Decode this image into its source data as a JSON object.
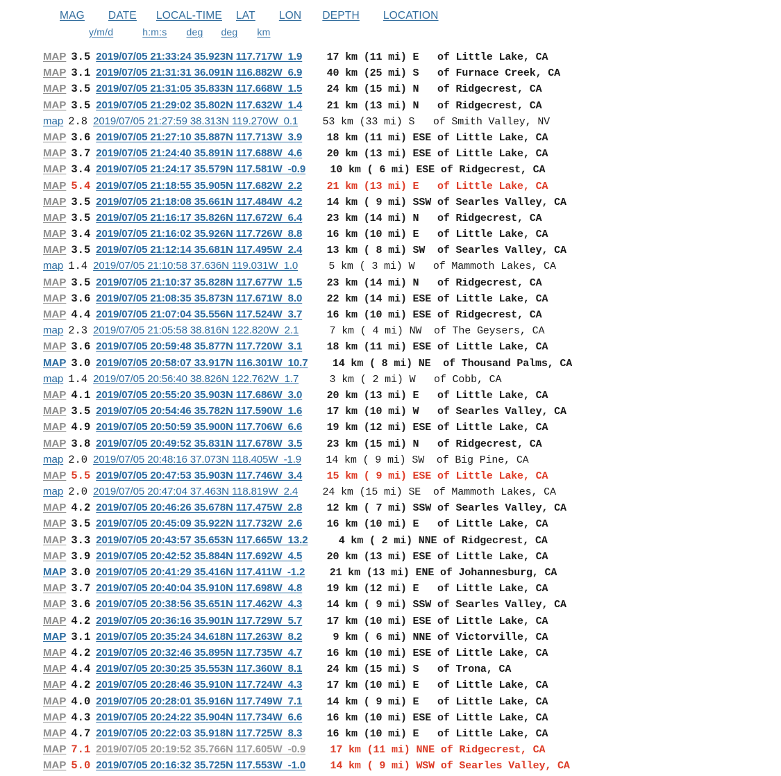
{
  "header": {
    "columns": [
      "MAG",
      "DATE",
      "LOCAL-TIME",
      "LAT",
      "LON",
      "DEPTH",
      "LOCATION"
    ],
    "units": [
      "y/m/d",
      "h:m:s",
      "deg",
      "deg",
      "km"
    ]
  },
  "colors": {
    "link_blue": "#2a6ba0",
    "link_visited_gray": "#8d8d8d",
    "alert_red": "#dd3b26",
    "text": "#1a1a1a",
    "background": "#ffffff"
  },
  "map_label_visited": "MAP",
  "map_label_unvisited": "map",
  "rows": [
    {
      "map": "MAP",
      "map_visited": true,
      "mag": "3.5",
      "date": "2019/07/05",
      "time": "21:33:24",
      "lat": "35.923N",
      "lon": "117.717W",
      "depth": "1.9",
      "dist_km": "17",
      "dist_mi": "11",
      "dir": "E",
      "place": "of Little Lake, CA",
      "bold": true,
      "red": false,
      "detail_visited": false
    },
    {
      "map": "MAP",
      "map_visited": true,
      "mag": "3.1",
      "date": "2019/07/05",
      "time": "21:31:31",
      "lat": "36.091N",
      "lon": "116.882W",
      "depth": "6.9",
      "dist_km": "40",
      "dist_mi": "25",
      "dir": "S",
      "place": "of Furnace Creek, CA",
      "bold": true,
      "red": false,
      "detail_visited": false
    },
    {
      "map": "MAP",
      "map_visited": true,
      "mag": "3.5",
      "date": "2019/07/05",
      "time": "21:31:05",
      "lat": "35.833N",
      "lon": "117.668W",
      "depth": "1.5",
      "dist_km": "24",
      "dist_mi": "15",
      "dir": "N",
      "place": "of Ridgecrest, CA",
      "bold": true,
      "red": false,
      "detail_visited": false
    },
    {
      "map": "MAP",
      "map_visited": true,
      "mag": "3.5",
      "date": "2019/07/05",
      "time": "21:29:02",
      "lat": "35.802N",
      "lon": "117.632W",
      "depth": "1.4",
      "dist_km": "21",
      "dist_mi": "13",
      "dir": "N",
      "place": "of Ridgecrest, CA",
      "bold": true,
      "red": false,
      "detail_visited": false
    },
    {
      "map": "map",
      "map_visited": false,
      "mag": "2.8",
      "date": "2019/07/05",
      "time": "21:27:59",
      "lat": "38.313N",
      "lon": "119.270W",
      "depth": "0.1",
      "dist_km": "53",
      "dist_mi": "33",
      "dir": "S",
      "place": "of Smith Valley, NV",
      "bold": false,
      "red": false,
      "detail_visited": false
    },
    {
      "map": "MAP",
      "map_visited": true,
      "mag": "3.6",
      "date": "2019/07/05",
      "time": "21:27:10",
      "lat": "35.887N",
      "lon": "117.713W",
      "depth": "3.9",
      "dist_km": "18",
      "dist_mi": "11",
      "dir": "ESE",
      "place": "of Little Lake, CA",
      "bold": true,
      "red": false,
      "detail_visited": false
    },
    {
      "map": "MAP",
      "map_visited": true,
      "mag": "3.7",
      "date": "2019/07/05",
      "time": "21:24:40",
      "lat": "35.891N",
      "lon": "117.688W",
      "depth": "4.6",
      "dist_km": "20",
      "dist_mi": "13",
      "dir": "ESE",
      "place": "of Little Lake, CA",
      "bold": true,
      "red": false,
      "detail_visited": false
    },
    {
      "map": "MAP",
      "map_visited": true,
      "mag": "3.4",
      "date": "2019/07/05",
      "time": "21:24:17",
      "lat": "35.579N",
      "lon": "117.581W",
      "depth": "-0.9",
      "dist_km": "10",
      "dist_mi": " 6",
      "dir": "ESE",
      "place": "of Ridgecrest, CA",
      "bold": true,
      "red": false,
      "detail_visited": false
    },
    {
      "map": "MAP",
      "map_visited": true,
      "mag": "5.4",
      "date": "2019/07/05",
      "time": "21:18:55",
      "lat": "35.905N",
      "lon": "117.682W",
      "depth": "2.2",
      "dist_km": "21",
      "dist_mi": "13",
      "dir": "E",
      "place": "of Little Lake, CA",
      "bold": true,
      "red": true,
      "detail_visited": false
    },
    {
      "map": "MAP",
      "map_visited": true,
      "mag": "3.5",
      "date": "2019/07/05",
      "time": "21:18:08",
      "lat": "35.661N",
      "lon": "117.484W",
      "depth": "4.2",
      "dist_km": "14",
      "dist_mi": " 9",
      "dir": "SSW",
      "place": "of Searles Valley, CA",
      "bold": true,
      "red": false,
      "detail_visited": false
    },
    {
      "map": "MAP",
      "map_visited": true,
      "mag": "3.5",
      "date": "2019/07/05",
      "time": "21:16:17",
      "lat": "35.826N",
      "lon": "117.672W",
      "depth": "6.4",
      "dist_km": "23",
      "dist_mi": "14",
      "dir": "N",
      "place": "of Ridgecrest, CA",
      "bold": true,
      "red": false,
      "detail_visited": false
    },
    {
      "map": "MAP",
      "map_visited": true,
      "mag": "3.4",
      "date": "2019/07/05",
      "time": "21:16:02",
      "lat": "35.926N",
      "lon": "117.726W",
      "depth": "8.8",
      "dist_km": "16",
      "dist_mi": "10",
      "dir": "E",
      "place": "of Little Lake, CA",
      "bold": true,
      "red": false,
      "detail_visited": false
    },
    {
      "map": "MAP",
      "map_visited": true,
      "mag": "3.5",
      "date": "2019/07/05",
      "time": "21:12:14",
      "lat": "35.681N",
      "lon": "117.495W",
      "depth": "2.4",
      "dist_km": "13",
      "dist_mi": " 8",
      "dir": "SW",
      "place": "of Searles Valley, CA",
      "bold": true,
      "red": false,
      "detail_visited": false
    },
    {
      "map": "map",
      "map_visited": false,
      "mag": "1.4",
      "date": "2019/07/05",
      "time": "21:10:58",
      "lat": "37.636N",
      "lon": "119.031W",
      "depth": "1.0",
      "dist_km": " 5",
      "dist_mi": " 3",
      "dir": "W",
      "place": "of Mammoth Lakes, CA",
      "bold": false,
      "red": false,
      "detail_visited": false
    },
    {
      "map": "MAP",
      "map_visited": true,
      "mag": "3.5",
      "date": "2019/07/05",
      "time": "21:10:37",
      "lat": "35.828N",
      "lon": "117.677W",
      "depth": "1.5",
      "dist_km": "23",
      "dist_mi": "14",
      "dir": "N",
      "place": "of Ridgecrest, CA",
      "bold": true,
      "red": false,
      "detail_visited": false
    },
    {
      "map": "MAP",
      "map_visited": true,
      "mag": "3.6",
      "date": "2019/07/05",
      "time": "21:08:35",
      "lat": "35.873N",
      "lon": "117.671W",
      "depth": "8.0",
      "dist_km": "22",
      "dist_mi": "14",
      "dir": "ESE",
      "place": "of Little Lake, CA",
      "bold": true,
      "red": false,
      "detail_visited": false
    },
    {
      "map": "MAP",
      "map_visited": true,
      "mag": "4.4",
      "date": "2019/07/05",
      "time": "21:07:04",
      "lat": "35.556N",
      "lon": "117.524W",
      "depth": "3.7",
      "dist_km": "16",
      "dist_mi": "10",
      "dir": "ESE",
      "place": "of Ridgecrest, CA",
      "bold": true,
      "red": false,
      "detail_visited": false
    },
    {
      "map": "map",
      "map_visited": false,
      "mag": "2.3",
      "date": "2019/07/05",
      "time": "21:05:58",
      "lat": "38.816N",
      "lon": "122.820W",
      "depth": "2.1",
      "dist_km": " 7",
      "dist_mi": " 4",
      "dir": "NW",
      "place": "of The Geysers, CA",
      "bold": false,
      "red": false,
      "detail_visited": false
    },
    {
      "map": "MAP",
      "map_visited": true,
      "mag": "3.6",
      "date": "2019/07/05",
      "time": "20:59:48",
      "lat": "35.877N",
      "lon": "117.720W",
      "depth": "3.1",
      "dist_km": "18",
      "dist_mi": "11",
      "dir": "ESE",
      "place": "of Little Lake, CA",
      "bold": true,
      "red": false,
      "detail_visited": false
    },
    {
      "map": "MAP",
      "map_visited": false,
      "mag": "3.0",
      "date": "2019/07/05",
      "time": "20:58:07",
      "lat": "33.917N",
      "lon": "116.301W",
      "depth": "10.7",
      "dist_km": "14",
      "dist_mi": " 8",
      "dir": "NE",
      "place": "of Thousand Palms, CA",
      "bold": true,
      "red": false,
      "detail_visited": false
    },
    {
      "map": "map",
      "map_visited": false,
      "mag": "1.4",
      "date": "2019/07/05",
      "time": "20:56:40",
      "lat": "38.826N",
      "lon": "122.762W",
      "depth": "1.7",
      "dist_km": " 3",
      "dist_mi": " 2",
      "dir": "W",
      "place": "of Cobb, CA",
      "bold": false,
      "red": false,
      "detail_visited": false
    },
    {
      "map": "MAP",
      "map_visited": true,
      "mag": "4.1",
      "date": "2019/07/05",
      "time": "20:55:20",
      "lat": "35.903N",
      "lon": "117.686W",
      "depth": "3.0",
      "dist_km": "20",
      "dist_mi": "13",
      "dir": "E",
      "place": "of Little Lake, CA",
      "bold": true,
      "red": false,
      "detail_visited": false
    },
    {
      "map": "MAP",
      "map_visited": true,
      "mag": "3.5",
      "date": "2019/07/05",
      "time": "20:54:46",
      "lat": "35.782N",
      "lon": "117.590W",
      "depth": "1.6",
      "dist_km": "17",
      "dist_mi": "10",
      "dir": "W",
      "place": "of Searles Valley, CA",
      "bold": true,
      "red": false,
      "detail_visited": false
    },
    {
      "map": "MAP",
      "map_visited": true,
      "mag": "4.9",
      "date": "2019/07/05",
      "time": "20:50:59",
      "lat": "35.900N",
      "lon": "117.706W",
      "depth": "6.6",
      "dist_km": "19",
      "dist_mi": "12",
      "dir": "ESE",
      "place": "of Little Lake, CA",
      "bold": true,
      "red": false,
      "detail_visited": false
    },
    {
      "map": "MAP",
      "map_visited": true,
      "mag": "3.8",
      "date": "2019/07/05",
      "time": "20:49:52",
      "lat": "35.831N",
      "lon": "117.678W",
      "depth": "3.5",
      "dist_km": "23",
      "dist_mi": "15",
      "dir": "N",
      "place": "of Ridgecrest, CA",
      "bold": true,
      "red": false,
      "detail_visited": false
    },
    {
      "map": "map",
      "map_visited": false,
      "mag": "2.0",
      "date": "2019/07/05",
      "time": "20:48:16",
      "lat": "37.073N",
      "lon": "118.405W",
      "depth": "-1.9",
      "dist_km": "14",
      "dist_mi": " 9",
      "dir": "SW",
      "place": "of Big Pine, CA",
      "bold": false,
      "red": false,
      "detail_visited": false
    },
    {
      "map": "MAP",
      "map_visited": true,
      "mag": "5.5",
      "date": "2019/07/05",
      "time": "20:47:53",
      "lat": "35.903N",
      "lon": "117.746W",
      "depth": "3.4",
      "dist_km": "15",
      "dist_mi": " 9",
      "dir": "ESE",
      "place": "of Little Lake, CA",
      "bold": true,
      "red": true,
      "detail_visited": false
    },
    {
      "map": "map",
      "map_visited": false,
      "mag": "2.0",
      "date": "2019/07/05",
      "time": "20:47:04",
      "lat": "37.463N",
      "lon": "118.819W",
      "depth": "2.4",
      "dist_km": "24",
      "dist_mi": "15",
      "dir": "SE",
      "place": "of Mammoth Lakes, CA",
      "bold": false,
      "red": false,
      "detail_visited": false
    },
    {
      "map": "MAP",
      "map_visited": true,
      "mag": "4.2",
      "date": "2019/07/05",
      "time": "20:46:26",
      "lat": "35.678N",
      "lon": "117.475W",
      "depth": "2.8",
      "dist_km": "12",
      "dist_mi": " 7",
      "dir": "SSW",
      "place": "of Searles Valley, CA",
      "bold": true,
      "red": false,
      "detail_visited": false
    },
    {
      "map": "MAP",
      "map_visited": true,
      "mag": "3.5",
      "date": "2019/07/05",
      "time": "20:45:09",
      "lat": "35.922N",
      "lon": "117.732W",
      "depth": "2.6",
      "dist_km": "16",
      "dist_mi": "10",
      "dir": "E",
      "place": "of Little Lake, CA",
      "bold": true,
      "red": false,
      "detail_visited": false
    },
    {
      "map": "MAP",
      "map_visited": true,
      "mag": "3.3",
      "date": "2019/07/05",
      "time": "20:43:57",
      "lat": "35.653N",
      "lon": "117.665W",
      "depth": "13.2",
      "dist_km": " 4",
      "dist_mi": " 2",
      "dir": "NNE",
      "place": "of Ridgecrest, CA",
      "bold": true,
      "red": false,
      "detail_visited": false
    },
    {
      "map": "MAP",
      "map_visited": true,
      "mag": "3.9",
      "date": "2019/07/05",
      "time": "20:42:52",
      "lat": "35.884N",
      "lon": "117.692W",
      "depth": "4.5",
      "dist_km": "20",
      "dist_mi": "13",
      "dir": "ESE",
      "place": "of Little Lake, CA",
      "bold": true,
      "red": false,
      "detail_visited": false
    },
    {
      "map": "MAP",
      "map_visited": false,
      "mag": "3.0",
      "date": "2019/07/05",
      "time": "20:41:29",
      "lat": "35.416N",
      "lon": "117.411W",
      "depth": "-1.2",
      "dist_km": "21",
      "dist_mi": "13",
      "dir": "ENE",
      "place": "of Johannesburg, CA",
      "bold": true,
      "red": false,
      "detail_visited": false
    },
    {
      "map": "MAP",
      "map_visited": true,
      "mag": "3.7",
      "date": "2019/07/05",
      "time": "20:40:04",
      "lat": "35.910N",
      "lon": "117.698W",
      "depth": "4.8",
      "dist_km": "19",
      "dist_mi": "12",
      "dir": "E",
      "place": "of Little Lake, CA",
      "bold": true,
      "red": false,
      "detail_visited": false
    },
    {
      "map": "MAP",
      "map_visited": true,
      "mag": "3.6",
      "date": "2019/07/05",
      "time": "20:38:56",
      "lat": "35.651N",
      "lon": "117.462W",
      "depth": "4.3",
      "dist_km": "14",
      "dist_mi": " 9",
      "dir": "SSW",
      "place": "of Searles Valley, CA",
      "bold": true,
      "red": false,
      "detail_visited": false
    },
    {
      "map": "MAP",
      "map_visited": true,
      "mag": "4.2",
      "date": "2019/07/05",
      "time": "20:36:16",
      "lat": "35.901N",
      "lon": "117.729W",
      "depth": "5.7",
      "dist_km": "17",
      "dist_mi": "10",
      "dir": "ESE",
      "place": "of Little Lake, CA",
      "bold": true,
      "red": false,
      "detail_visited": false
    },
    {
      "map": "MAP",
      "map_visited": false,
      "mag": "3.1",
      "date": "2019/07/05",
      "time": "20:35:24",
      "lat": "34.618N",
      "lon": "117.263W",
      "depth": "8.2",
      "dist_km": " 9",
      "dist_mi": " 6",
      "dir": "NNE",
      "place": "of Victorville, CA",
      "bold": true,
      "red": false,
      "detail_visited": false
    },
    {
      "map": "MAP",
      "map_visited": true,
      "mag": "4.2",
      "date": "2019/07/05",
      "time": "20:32:46",
      "lat": "35.895N",
      "lon": "117.735W",
      "depth": "4.7",
      "dist_km": "16",
      "dist_mi": "10",
      "dir": "ESE",
      "place": "of Little Lake, CA",
      "bold": true,
      "red": false,
      "detail_visited": false
    },
    {
      "map": "MAP",
      "map_visited": true,
      "mag": "4.4",
      "date": "2019/07/05",
      "time": "20:30:25",
      "lat": "35.553N",
      "lon": "117.360W",
      "depth": "8.1",
      "dist_km": "24",
      "dist_mi": "15",
      "dir": "S",
      "place": "of Trona, CA",
      "bold": true,
      "red": false,
      "detail_visited": false
    },
    {
      "map": "MAP",
      "map_visited": true,
      "mag": "4.2",
      "date": "2019/07/05",
      "time": "20:28:46",
      "lat": "35.910N",
      "lon": "117.724W",
      "depth": "4.3",
      "dist_km": "17",
      "dist_mi": "10",
      "dir": "E",
      "place": "of Little Lake, CA",
      "bold": true,
      "red": false,
      "detail_visited": false
    },
    {
      "map": "MAP",
      "map_visited": true,
      "mag": "4.0",
      "date": "2019/07/05",
      "time": "20:28:01",
      "lat": "35.916N",
      "lon": "117.749W",
      "depth": "7.1",
      "dist_km": "14",
      "dist_mi": " 9",
      "dir": "E",
      "place": "of Little Lake, CA",
      "bold": true,
      "red": false,
      "detail_visited": false
    },
    {
      "map": "MAP",
      "map_visited": true,
      "mag": "4.3",
      "date": "2019/07/05",
      "time": "20:24:22",
      "lat": "35.904N",
      "lon": "117.734W",
      "depth": "6.6",
      "dist_km": "16",
      "dist_mi": "10",
      "dir": "ESE",
      "place": "of Little Lake, CA",
      "bold": true,
      "red": false,
      "detail_visited": false
    },
    {
      "map": "MAP",
      "map_visited": true,
      "mag": "4.7",
      "date": "2019/07/05",
      "time": "20:22:03",
      "lat": "35.918N",
      "lon": "117.725W",
      "depth": "8.3",
      "dist_km": "16",
      "dist_mi": "10",
      "dir": "E",
      "place": "of Little Lake, CA",
      "bold": true,
      "red": false,
      "detail_visited": false
    },
    {
      "map": "MAP",
      "map_visited": true,
      "mag": "7.1",
      "date": "2019/07/05",
      "time": "20:19:52",
      "lat": "35.766N",
      "lon": "117.605W",
      "depth": "-0.9",
      "dist_km": "17",
      "dist_mi": "11",
      "dir": "NNE",
      "place": "of Ridgecrest, CA",
      "bold": true,
      "red": true,
      "detail_visited": true
    },
    {
      "map": "MAP",
      "map_visited": true,
      "mag": "5.0",
      "date": "2019/07/05",
      "time": "20:16:32",
      "lat": "35.725N",
      "lon": "117.553W",
      "depth": "-1.0",
      "dist_km": "14",
      "dist_mi": " 9",
      "dir": "WSW",
      "place": "of Searles Valley, CA",
      "bold": true,
      "red": true,
      "detail_visited": false
    }
  ]
}
